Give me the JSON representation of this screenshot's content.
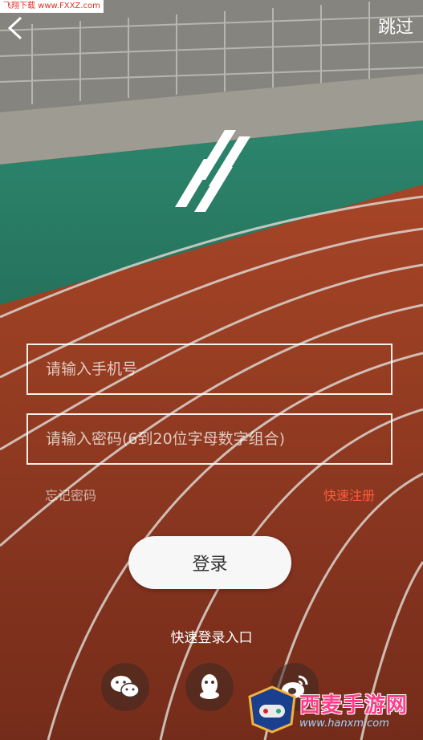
{
  "header": {
    "watermark_top": "飞翔下载 www.FXXZ.com",
    "back_icon": "chevron-left-icon",
    "skip_label": "跳过"
  },
  "brand": {
    "logo_icon": "brand-slash-logo"
  },
  "form": {
    "phone_placeholder": "请输入手机号",
    "password_placeholder": "请输入密码(6到20位字母数字组合)",
    "forgot_label": "忘记密码",
    "register_label": "快速注册",
    "login_label": "登录"
  },
  "quick_login": {
    "label": "快速登录入口",
    "providers": [
      {
        "name": "wechat",
        "icon": "wechat-icon"
      },
      {
        "name": "qq",
        "icon": "qq-icon"
      },
      {
        "name": "weibo",
        "icon": "weibo-icon"
      }
    ]
  },
  "watermark_bottom": {
    "text": "西麦手游网",
    "url": "www.hanxm.com"
  },
  "colors": {
    "accent": "#ff5a3c",
    "track": "#9a3a1f",
    "field_turf": "#2e8a70"
  }
}
